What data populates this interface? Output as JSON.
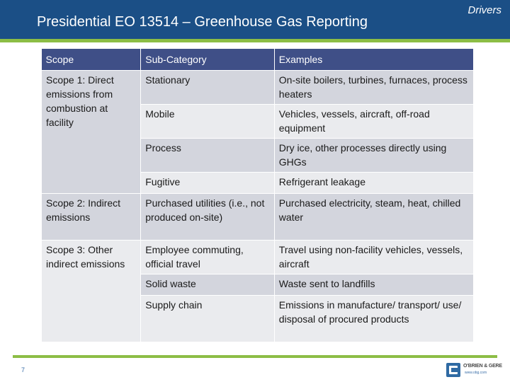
{
  "header": {
    "section_label": "Drivers",
    "title": "Presidential EO 13514 – Greenhouse Gas Reporting"
  },
  "table": {
    "columns": [
      "Scope",
      "Sub-Category",
      "Examples"
    ],
    "groups": [
      {
        "scope": "Scope 1: Direct emissions from combustion at facility",
        "rows": [
          {
            "sub": "Stationary",
            "ex": "On-site boilers, turbines, furnaces, process heaters"
          },
          {
            "sub": "Mobile",
            "ex": "Vehicles, vessels, aircraft, off-road equipment"
          },
          {
            "sub": "Process",
            "ex": "Dry ice, other processes directly using GHGs"
          },
          {
            "sub": "Fugitive",
            "ex": "Refrigerant leakage"
          }
        ]
      },
      {
        "scope": "Scope 2: Indirect emissions",
        "rows": [
          {
            "sub": "Purchased utilities (i.e., not produced on-site)",
            "ex": "Purchased electricity, steam, heat, chilled water"
          }
        ]
      },
      {
        "scope": "Scope 3: Other indirect emissions",
        "rows": [
          {
            "sub": "Employee commuting, official travel",
            "ex": "Travel using non-facility vehicles, vessels, aircraft"
          },
          {
            "sub": "Solid waste",
            "ex": "Waste sent to landfills"
          },
          {
            "sub": "Supply chain",
            "ex": "Emissions in manufacture/ transport/ use/ disposal of procured products"
          }
        ]
      }
    ]
  },
  "footer": {
    "page_number": "7",
    "logo_name": "O'BRIEN & GERE",
    "logo_url": "www.obg.com"
  },
  "colors": {
    "header_blue": "#1b4f86",
    "accent_green": "#8cbd45",
    "table_header": "#3f4f87",
    "row_dark": "#d3d5dd",
    "row_light": "#eaebee"
  }
}
